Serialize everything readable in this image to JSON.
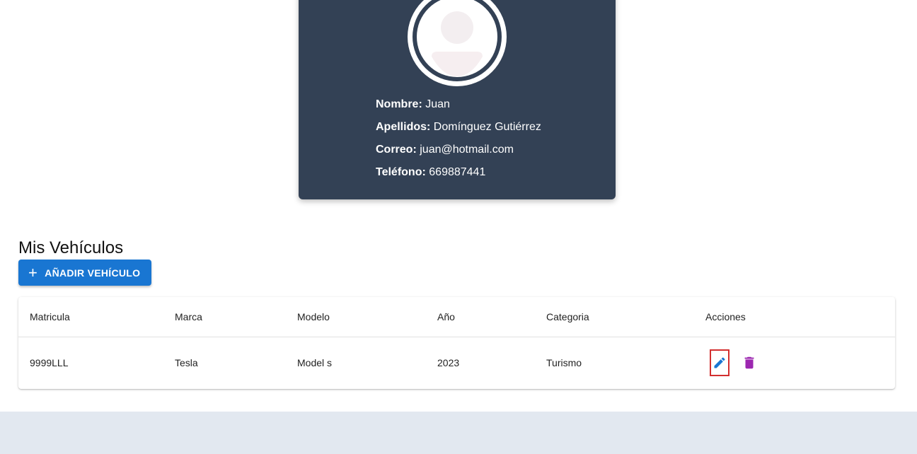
{
  "profile": {
    "fields": [
      {
        "label": "Nombre:",
        "value": "Juan"
      },
      {
        "label": "Apellidos:",
        "value": "Domínguez Gutiérrez"
      },
      {
        "label": "Correo:",
        "value": "juan@hotmail.com"
      },
      {
        "label": "Teléfono:",
        "value": "669887441"
      }
    ],
    "avatar_icon": "user-avatar-icon",
    "card_color": "#334155"
  },
  "vehicles": {
    "title": "Mis Vehículos",
    "add_button_label": "AÑADIR VEHÍCULO",
    "add_button_icon": "plus-icon",
    "columns": [
      "Matricula",
      "Marca",
      "Modelo",
      "Año",
      "Categoria",
      "Acciones"
    ],
    "rows": [
      {
        "matricula": "9999LLL",
        "marca": "Tesla",
        "modelo": "Model s",
        "anio": "2023",
        "categoria": "Turismo"
      }
    ],
    "edit_icon": "pencil-icon",
    "delete_icon": "trash-icon",
    "colors": {
      "primary": "#1976d2",
      "delete": "#9c27b0",
      "footer": "#e2e8f0"
    }
  }
}
